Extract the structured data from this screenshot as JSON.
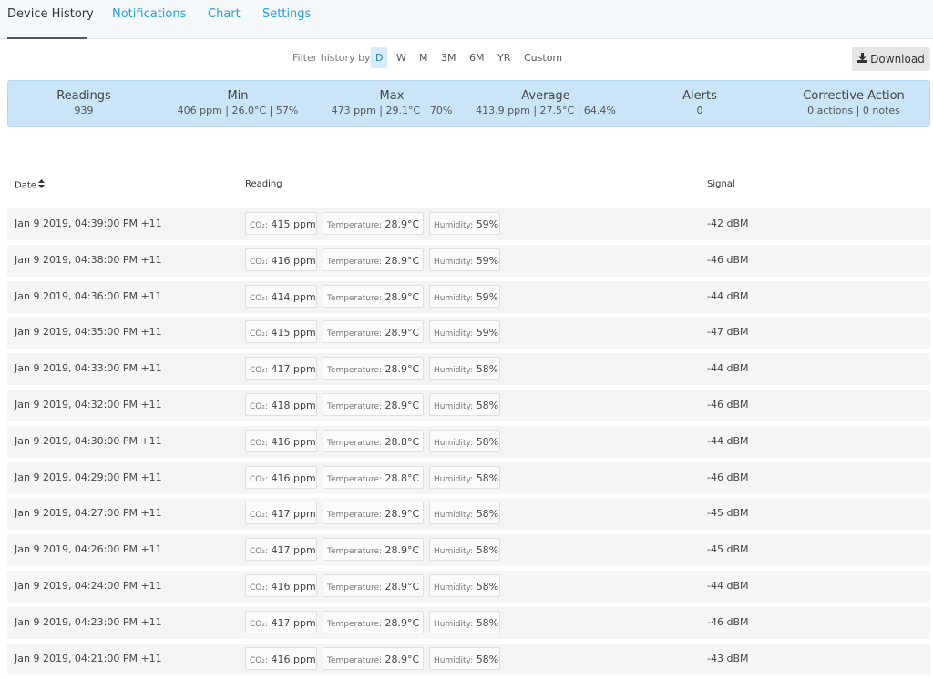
{
  "tabs": [
    {
      "label": "Device History",
      "active": true
    },
    {
      "label": "Notifications",
      "active": false
    },
    {
      "label": "Chart",
      "active": false
    },
    {
      "label": "Settings",
      "active": false
    }
  ],
  "filter": {
    "label": "Filter history by:",
    "options": [
      "D",
      "W",
      "M",
      "3M",
      "6M",
      "YR",
      "Custom"
    ],
    "selected": "D"
  },
  "download_label": "Download",
  "summary": {
    "readings": {
      "title": "Readings",
      "value": "939"
    },
    "min": {
      "title": "Min",
      "value": "406 ppm | 26.0°C | 57%"
    },
    "max": {
      "title": "Max",
      "value": "473 ppm | 29.1°C | 70%"
    },
    "average": {
      "title": "Average",
      "value": "413.9 ppm | 27.5°C | 64.4%"
    },
    "alerts": {
      "title": "Alerts",
      "value": "0"
    },
    "corrective": {
      "title": "Corrective Action",
      "value": "0 actions | 0 notes"
    }
  },
  "table": {
    "headers": {
      "date": "Date",
      "reading": "Reading",
      "signal": "Signal"
    },
    "co2_label": "CO₂:",
    "temp_label": "Temperature:",
    "hum_label": "Humidity:",
    "rows": [
      {
        "date": "Jan 9 2019, 04:39:00 PM +11",
        "co2": "415 ppm",
        "temp": "28.9°C",
        "hum": "59%",
        "signal": "-42 dBM"
      },
      {
        "date": "Jan 9 2019, 04:38:00 PM +11",
        "co2": "416 ppm",
        "temp": "28.9°C",
        "hum": "59%",
        "signal": "-46 dBM"
      },
      {
        "date": "Jan 9 2019, 04:36:00 PM +11",
        "co2": "414 ppm",
        "temp": "28.9°C",
        "hum": "59%",
        "signal": "-44 dBM"
      },
      {
        "date": "Jan 9 2019, 04:35:00 PM +11",
        "co2": "415 ppm",
        "temp": "28.9°C",
        "hum": "59%",
        "signal": "-47 dBM"
      },
      {
        "date": "Jan 9 2019, 04:33:00 PM +11",
        "co2": "417 ppm",
        "temp": "28.9°C",
        "hum": "58%",
        "signal": "-44 dBM"
      },
      {
        "date": "Jan 9 2019, 04:32:00 PM +11",
        "co2": "418 ppm",
        "temp": "28.9°C",
        "hum": "58%",
        "signal": "-46 dBM"
      },
      {
        "date": "Jan 9 2019, 04:30:00 PM +11",
        "co2": "416 ppm",
        "temp": "28.8°C",
        "hum": "58%",
        "signal": "-44 dBM"
      },
      {
        "date": "Jan 9 2019, 04:29:00 PM +11",
        "co2": "416 ppm",
        "temp": "28.8°C",
        "hum": "58%",
        "signal": "-46 dBM"
      },
      {
        "date": "Jan 9 2019, 04:27:00 PM +11",
        "co2": "417 ppm",
        "temp": "28.9°C",
        "hum": "58%",
        "signal": "-45 dBM"
      },
      {
        "date": "Jan 9 2019, 04:26:00 PM +11",
        "co2": "417 ppm",
        "temp": "28.9°C",
        "hum": "58%",
        "signal": "-45 dBM"
      },
      {
        "date": "Jan 9 2019, 04:24:00 PM +11",
        "co2": "416 ppm",
        "temp": "28.9°C",
        "hum": "58%",
        "signal": "-44 dBM"
      },
      {
        "date": "Jan 9 2019, 04:23:00 PM +11",
        "co2": "417 ppm",
        "temp": "28.9°C",
        "hum": "58%",
        "signal": "-46 dBM"
      },
      {
        "date": "Jan 9 2019, 04:21:00 PM +11",
        "co2": "416 ppm",
        "temp": "28.9°C",
        "hum": "58%",
        "signal": "-43 dBM"
      }
    ]
  },
  "colors": {
    "accent": "#2a9fd6",
    "summary_bg": "#c9e5f7",
    "row_bg": "#f5f5f5"
  }
}
